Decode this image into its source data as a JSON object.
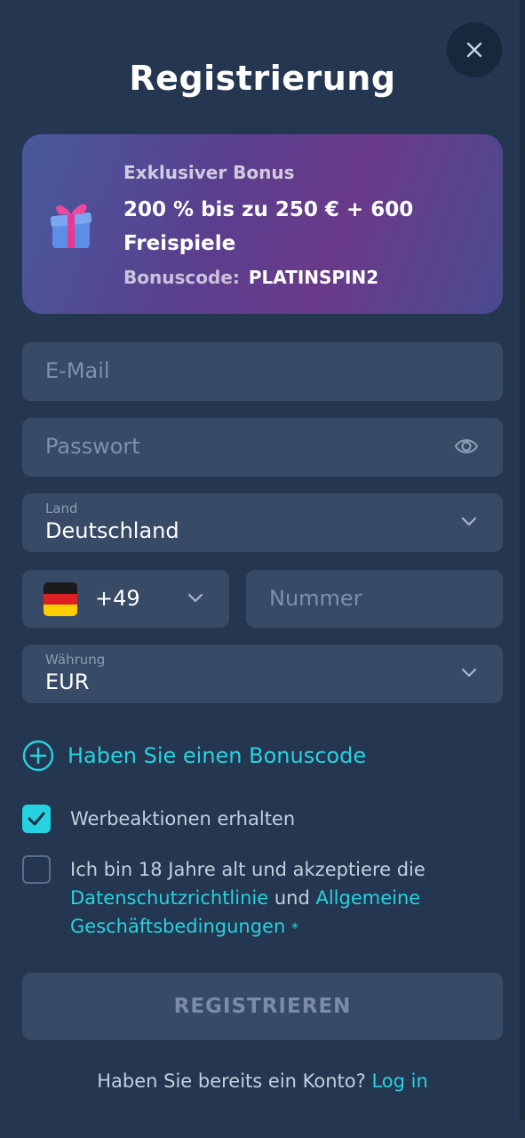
{
  "header": {
    "title": "Registrierung"
  },
  "bonus": {
    "eyebrow": "Exklusiver Bonus",
    "main": "200 % bis zu 250 € + 600 Freispiele",
    "code_label": "Bonuscode:",
    "code_value": "PLATINSPIN2"
  },
  "form": {
    "email_placeholder": "E-Mail",
    "password_placeholder": "Passwort",
    "country_label": "Land",
    "country_value": "Deutschland",
    "phone_code": "+49",
    "phone_placeholder": "Nummer",
    "currency_label": "Währung",
    "currency_value": "EUR"
  },
  "bonus_link": "Haben Sie einen Bonuscode",
  "checkboxes": {
    "promotions": {
      "label": "Werbeaktionen erhalten",
      "checked": true
    },
    "terms": {
      "text_before": "Ich bin 18 Jahre alt und akzeptiere die",
      "privacy_link": "Datenschutzrichtlinie",
      "and": "und",
      "terms_link_1": "Allgemeine",
      "terms_link_2": "Geschäftsbedingungen",
      "asterisk": "*",
      "checked": false
    }
  },
  "register_button": "REGISTRIEREN",
  "footer": {
    "question": "Haben Sie bereits ein Konto?",
    "login_link": "Log in"
  },
  "colors": {
    "background": "#243650",
    "field": "#374b67",
    "accent": "#25d3e0",
    "close_button": "#17283d"
  },
  "icons": [
    "close-icon",
    "gift-icon",
    "eye-icon",
    "chevron-down-icon",
    "germany-flag-icon",
    "plus-circle-icon",
    "check-icon"
  ]
}
